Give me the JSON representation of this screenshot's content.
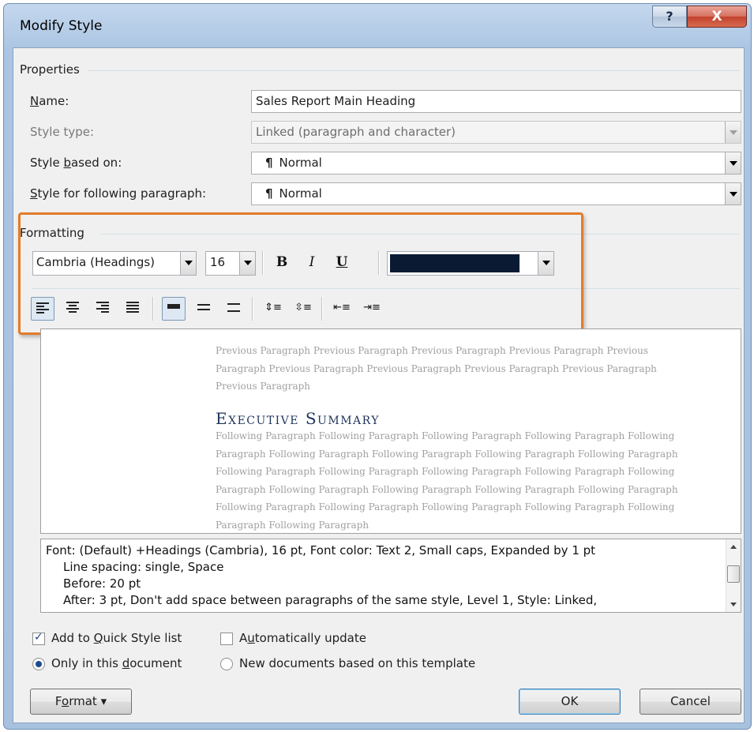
{
  "window": {
    "title": "Modify Style",
    "help_label": "?",
    "close_label": "X"
  },
  "properties": {
    "section_label": "Properties",
    "name_label_pre": "",
    "name_label_u": "N",
    "name_label_post": "ame:",
    "name_value": "Sales Report Main Heading",
    "style_type_label": "Style type:",
    "style_type_value": "Linked (paragraph and character)",
    "based_on_label_pre": "Style ",
    "based_on_label_u": "b",
    "based_on_label_post": "ased on:",
    "based_on_value": "Normal",
    "following_label_pre": "",
    "following_label_u": "S",
    "following_label_post": "tyle for following paragraph:",
    "following_value": "Normal",
    "pilcrow": "¶"
  },
  "formatting": {
    "section_label": "Formatting",
    "font_value": "Cambria (Headings)",
    "size_value": "16",
    "bold_label": "B",
    "italic_label": "I",
    "underline_label": "U",
    "font_color": "#0b1a33",
    "toolbar_icons": [
      "align-left-icon",
      "align-center-icon",
      "align-right-icon",
      "justify-icon",
      "single-spacing-icon",
      "one-half-spacing-icon",
      "double-spacing-icon",
      "space-before-icon",
      "space-after-icon",
      "decrease-indent-icon",
      "increase-indent-icon"
    ]
  },
  "preview": {
    "previous_paragraph": "Previous Paragraph Previous Paragraph Previous Paragraph Previous Paragraph Previous Paragraph Previous Paragraph Previous Paragraph Previous Paragraph Previous Paragraph Previous Paragraph",
    "heading": "Executive Summary",
    "following_paragraph": "Following Paragraph Following Paragraph Following Paragraph Following Paragraph Following Paragraph Following Paragraph Following Paragraph Following Paragraph Following Paragraph Following Paragraph Following Paragraph Following Paragraph Following Paragraph Following Paragraph Following Paragraph Following Paragraph Following Paragraph Following Paragraph Following Paragraph Following Paragraph Following Paragraph Following Paragraph Following Paragraph Following Paragraph"
  },
  "description": {
    "line1": "Font: (Default) +Headings (Cambria), 16 pt, Font color: Text 2, Small caps, Expanded by  1 pt",
    "line2": "Line spacing:  single, Space",
    "line3": "Before:  20 pt",
    "line4": "After:  3 pt, Don't add space between paragraphs of the same style, Level 1, Style: Linked,"
  },
  "options": {
    "quick_style_pre": "Add to ",
    "quick_style_u": "Q",
    "quick_style_post": "uick Style list",
    "quick_style_checked": true,
    "auto_update_pre": "A",
    "auto_update_u": "u",
    "auto_update_post": "tomatically update",
    "auto_update_checked": false,
    "only_doc_pre": "Only in this ",
    "only_doc_u": "d",
    "only_doc_post": "ocument",
    "only_doc_selected": true,
    "new_docs_label": "New documents based on this template",
    "new_docs_selected": false
  },
  "buttons": {
    "format_pre": "F",
    "format_u": "o",
    "format_post": "rmat",
    "format_arrow": "▾",
    "ok_label": "OK",
    "cancel_label": "Cancel"
  },
  "colors": {
    "highlight": "#e47b28",
    "title_bar": "#b3cbe6",
    "heading_color": "#1f355d"
  }
}
